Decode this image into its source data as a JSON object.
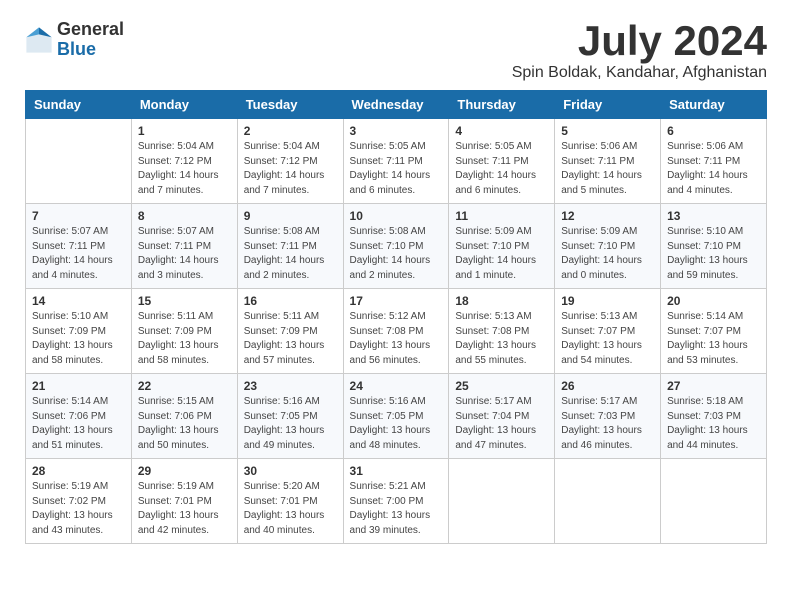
{
  "logo": {
    "general": "General",
    "blue": "Blue"
  },
  "title": "July 2024",
  "location": "Spin Boldak, Kandahar, Afghanistan",
  "days_of_week": [
    "Sunday",
    "Monday",
    "Tuesday",
    "Wednesday",
    "Thursday",
    "Friday",
    "Saturday"
  ],
  "weeks": [
    [
      {
        "day": "",
        "info": ""
      },
      {
        "day": "1",
        "info": "Sunrise: 5:04 AM\nSunset: 7:12 PM\nDaylight: 14 hours\nand 7 minutes."
      },
      {
        "day": "2",
        "info": "Sunrise: 5:04 AM\nSunset: 7:12 PM\nDaylight: 14 hours\nand 7 minutes."
      },
      {
        "day": "3",
        "info": "Sunrise: 5:05 AM\nSunset: 7:11 PM\nDaylight: 14 hours\nand 6 minutes."
      },
      {
        "day": "4",
        "info": "Sunrise: 5:05 AM\nSunset: 7:11 PM\nDaylight: 14 hours\nand 6 minutes."
      },
      {
        "day": "5",
        "info": "Sunrise: 5:06 AM\nSunset: 7:11 PM\nDaylight: 14 hours\nand 5 minutes."
      },
      {
        "day": "6",
        "info": "Sunrise: 5:06 AM\nSunset: 7:11 PM\nDaylight: 14 hours\nand 4 minutes."
      }
    ],
    [
      {
        "day": "7",
        "info": "Sunrise: 5:07 AM\nSunset: 7:11 PM\nDaylight: 14 hours\nand 4 minutes."
      },
      {
        "day": "8",
        "info": "Sunrise: 5:07 AM\nSunset: 7:11 PM\nDaylight: 14 hours\nand 3 minutes."
      },
      {
        "day": "9",
        "info": "Sunrise: 5:08 AM\nSunset: 7:11 PM\nDaylight: 14 hours\nand 2 minutes."
      },
      {
        "day": "10",
        "info": "Sunrise: 5:08 AM\nSunset: 7:10 PM\nDaylight: 14 hours\nand 2 minutes."
      },
      {
        "day": "11",
        "info": "Sunrise: 5:09 AM\nSunset: 7:10 PM\nDaylight: 14 hours\nand 1 minute."
      },
      {
        "day": "12",
        "info": "Sunrise: 5:09 AM\nSunset: 7:10 PM\nDaylight: 14 hours\nand 0 minutes."
      },
      {
        "day": "13",
        "info": "Sunrise: 5:10 AM\nSunset: 7:10 PM\nDaylight: 13 hours\nand 59 minutes."
      }
    ],
    [
      {
        "day": "14",
        "info": "Sunrise: 5:10 AM\nSunset: 7:09 PM\nDaylight: 13 hours\nand 58 minutes."
      },
      {
        "day": "15",
        "info": "Sunrise: 5:11 AM\nSunset: 7:09 PM\nDaylight: 13 hours\nand 58 minutes."
      },
      {
        "day": "16",
        "info": "Sunrise: 5:11 AM\nSunset: 7:09 PM\nDaylight: 13 hours\nand 57 minutes."
      },
      {
        "day": "17",
        "info": "Sunrise: 5:12 AM\nSunset: 7:08 PM\nDaylight: 13 hours\nand 56 minutes."
      },
      {
        "day": "18",
        "info": "Sunrise: 5:13 AM\nSunset: 7:08 PM\nDaylight: 13 hours\nand 55 minutes."
      },
      {
        "day": "19",
        "info": "Sunrise: 5:13 AM\nSunset: 7:07 PM\nDaylight: 13 hours\nand 54 minutes."
      },
      {
        "day": "20",
        "info": "Sunrise: 5:14 AM\nSunset: 7:07 PM\nDaylight: 13 hours\nand 53 minutes."
      }
    ],
    [
      {
        "day": "21",
        "info": "Sunrise: 5:14 AM\nSunset: 7:06 PM\nDaylight: 13 hours\nand 51 minutes."
      },
      {
        "day": "22",
        "info": "Sunrise: 5:15 AM\nSunset: 7:06 PM\nDaylight: 13 hours\nand 50 minutes."
      },
      {
        "day": "23",
        "info": "Sunrise: 5:16 AM\nSunset: 7:05 PM\nDaylight: 13 hours\nand 49 minutes."
      },
      {
        "day": "24",
        "info": "Sunrise: 5:16 AM\nSunset: 7:05 PM\nDaylight: 13 hours\nand 48 minutes."
      },
      {
        "day": "25",
        "info": "Sunrise: 5:17 AM\nSunset: 7:04 PM\nDaylight: 13 hours\nand 47 minutes."
      },
      {
        "day": "26",
        "info": "Sunrise: 5:17 AM\nSunset: 7:03 PM\nDaylight: 13 hours\nand 46 minutes."
      },
      {
        "day": "27",
        "info": "Sunrise: 5:18 AM\nSunset: 7:03 PM\nDaylight: 13 hours\nand 44 minutes."
      }
    ],
    [
      {
        "day": "28",
        "info": "Sunrise: 5:19 AM\nSunset: 7:02 PM\nDaylight: 13 hours\nand 43 minutes."
      },
      {
        "day": "29",
        "info": "Sunrise: 5:19 AM\nSunset: 7:01 PM\nDaylight: 13 hours\nand 42 minutes."
      },
      {
        "day": "30",
        "info": "Sunrise: 5:20 AM\nSunset: 7:01 PM\nDaylight: 13 hours\nand 40 minutes."
      },
      {
        "day": "31",
        "info": "Sunrise: 5:21 AM\nSunset: 7:00 PM\nDaylight: 13 hours\nand 39 minutes."
      },
      {
        "day": "",
        "info": ""
      },
      {
        "day": "",
        "info": ""
      },
      {
        "day": "",
        "info": ""
      }
    ]
  ]
}
